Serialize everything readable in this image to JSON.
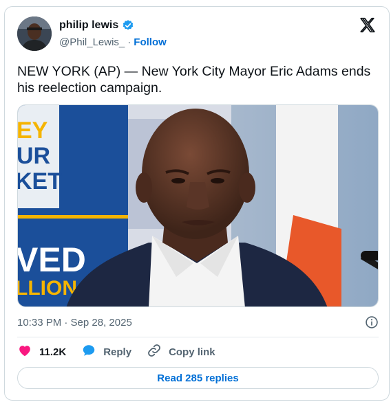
{
  "author": {
    "name": "philip lewis",
    "handle": "@Phil_Lewis_",
    "separator": "·",
    "follow_label": "Follow"
  },
  "tweet": {
    "text": "NEW YORK (AP) — New York City Mayor Eric Adams ends his reelection campaign.",
    "timestamp": "10:33 PM · Sep 28, 2025"
  },
  "media": {
    "sign_lines": [
      "EY",
      "UR",
      "KET",
      "VED",
      "LLION"
    ]
  },
  "actions": {
    "likes": "11.2K",
    "reply_label": "Reply",
    "copy_label": "Copy link"
  },
  "replies_button": "Read 285 replies",
  "colors": {
    "accent": "#006fd6",
    "like_heart": "#f91880",
    "reply_bubble": "#1d9bf0",
    "muted_text": "#536471"
  }
}
